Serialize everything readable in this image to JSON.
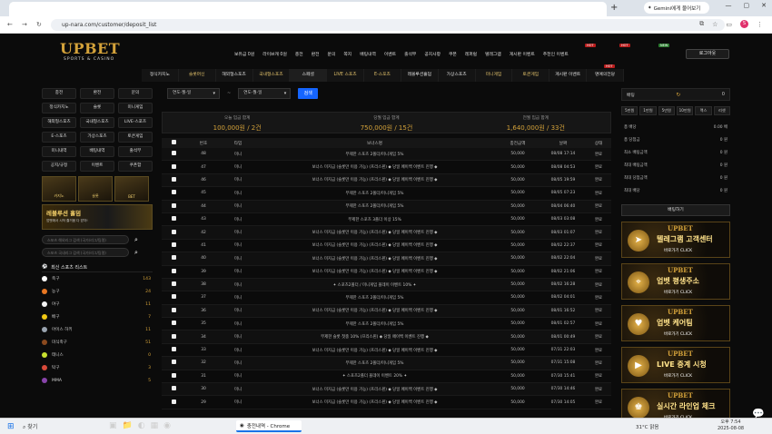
{
  "browser": {
    "gemini_label": "Gemini에게 물어보기",
    "url": "up-nara.com/customer/deposit_list",
    "profile_initial": "S"
  },
  "site": {
    "logo": "UPBET",
    "logo_sub": "SPORTS & CASINO",
    "top_links": [
      "보유금 0원",
      "라이브캐 0원",
      "충전",
      "환전",
      "문의",
      "쪽지",
      "배팅내역",
      "이벤트",
      "출석부",
      "공지사항",
      "쿠폰",
      "레퍼럴",
      "텔레그램",
      "게시판 이벤트",
      "추천인 이벤트"
    ],
    "hot_label": "HOT",
    "new_label": "NEW",
    "logout_label": "로그아웃",
    "main_nav": [
      "정식카지노",
      "슬롯머신",
      "해외형스포츠",
      "국내형스포츠",
      "스페셜",
      "LIVE 스포츠",
      "E-스포츠",
      "레볼루션홀덤",
      "가상스포츠",
      "미니게임",
      "토큰게임",
      "게시판 이벤트",
      "명예의전당"
    ]
  },
  "left": {
    "grid": [
      "충전",
      "환전",
      "문의",
      "정식카지노",
      "슬롯",
      "미니게임",
      "해외형스포츠",
      "국내형스포츠",
      "LIVE-스포츠",
      "E-스포츠",
      "가상스포츠",
      "토큰게임",
      "미니내역",
      "배팅내역",
      "출석부",
      "공지/규정",
      "이벤트",
      "쿠폰함"
    ],
    "banners": [
      "카지노",
      "슬롯",
      "BET"
    ],
    "evo_title": "레볼루션 홀덤",
    "evo_sub": "업벳에서 시작 즐거움 다 받자!",
    "search_placeholders": [
      "스포츠 해외리그 검색 (국가/리그/팀명)",
      "스포츠 국내리그 검색 (국가/리그/팀명)"
    ],
    "sports_head": "최신 스포츠 리스트",
    "sports": [
      {
        "name": "축구",
        "count": "143",
        "color": "#ffffff"
      },
      {
        "name": "농구",
        "count": "24",
        "color": "#e87722"
      },
      {
        "name": "야구",
        "count": "11",
        "color": "#f4f4f4"
      },
      {
        "name": "배구",
        "count": "7",
        "color": "#f0c814"
      },
      {
        "name": "아이스 하키",
        "count": "11",
        "color": "#9aa4b0"
      },
      {
        "name": "미식축구",
        "count": "51",
        "color": "#8b4a1e"
      },
      {
        "name": "테니스",
        "count": "0",
        "color": "#c8e030"
      },
      {
        "name": "탁구",
        "count": "3",
        "color": "#d84a3a"
      },
      {
        "name": "MMA",
        "count": "5",
        "color": "#8844aa"
      }
    ]
  },
  "content": {
    "date_placeholder": "연도-월-일",
    "search_label": "검색",
    "summary": [
      {
        "label": "오늘 입금 합계",
        "value": "100,000원 / 2건"
      },
      {
        "label": "당월 입금 합계",
        "value": "750,000원 / 15건"
      },
      {
        "label": "전월 입금 합계",
        "value": "1,640,000원 / 33건"
      }
    ],
    "headers": [
      "번호",
      "타입",
      "보너스명",
      "충전금액",
      "날짜",
      "상태"
    ],
    "rows": [
      {
        "no": "48",
        "type": "미니",
        "bonus": "무제한 스포츠 2폴더/미니게임 5%",
        "amount": "50,000",
        "date": "08/08 17:14",
        "status": "완료"
      },
      {
        "no": "47",
        "type": "미니",
        "bonus": "보너스 미지급 (슬롯만 이용 가능) (프리스핀) ◆ 당일 페이백 이벤트 진행 ◆",
        "amount": "50,000",
        "date": "08/08 04:53",
        "status": "완료"
      },
      {
        "no": "46",
        "type": "미니",
        "bonus": "보너스 미지급 (슬롯만 이용 가능) (프리스핀) ◆ 당일 페이백 이벤트 진행 ◆",
        "amount": "50,000",
        "date": "08/05 19:59",
        "status": "완료"
      },
      {
        "no": "45",
        "type": "미니",
        "bonus": "무제한 스포츠 2폴더/미니게임 5%",
        "amount": "50,000",
        "date": "08/05 07:23",
        "status": "완료"
      },
      {
        "no": "44",
        "type": "미니",
        "bonus": "무제한 스포츠 2폴더/미니게임 5%",
        "amount": "50,000",
        "date": "08/04 06:40",
        "status": "완료"
      },
      {
        "no": "43",
        "type": "미니",
        "bonus": "무제한 스포츠 3폴더 이상 15%",
        "amount": "50,000",
        "date": "08/03 03:08",
        "status": "완료"
      },
      {
        "no": "42",
        "type": "미니",
        "bonus": "보너스 미지급 (슬롯만 이용 가능) (프리스핀) ◆ 당일 페이백 이벤트 진행 ◆",
        "amount": "50,000",
        "date": "08/03 01:07",
        "status": "완료"
      },
      {
        "no": "41",
        "type": "미니",
        "bonus": "보너스 미지급 (슬롯만 이용 가능) (프리스핀) ◆ 당일 페이백 이벤트 진행 ◆",
        "amount": "50,000",
        "date": "08/02 22:37",
        "status": "완료"
      },
      {
        "no": "40",
        "type": "미니",
        "bonus": "보너스 미지급 (슬롯만 이용 가능) (프리스핀) ◆ 당일 페이백 이벤트 진행 ◆",
        "amount": "50,000",
        "date": "08/02 22:04",
        "status": "완료"
      },
      {
        "no": "39",
        "type": "미니",
        "bonus": "보너스 미지급 (슬롯만 이용 가능) (프리스핀) ◆ 당일 페이백 이벤트 진행 ◆",
        "amount": "50,000",
        "date": "08/02 21:06",
        "status": "완료"
      },
      {
        "no": "38",
        "type": "미니",
        "bonus": "✦ 스포츠2폴더 / 미니게임 올데이 이벤트 10% ✦",
        "amount": "50,000",
        "date": "08/02 16:28",
        "status": "완료"
      },
      {
        "no": "37",
        "type": "미니",
        "bonus": "무제한 스포츠 2폴더/미니게임 5%",
        "amount": "50,000",
        "date": "08/02 04:01",
        "status": "완료"
      },
      {
        "no": "36",
        "type": "미니",
        "bonus": "보너스 미지급 (슬롯만 이용 가능) (프리스핀) ◆ 당일 페이백 이벤트 진행 ◆",
        "amount": "50,000",
        "date": "08/01 16:52",
        "status": "완료"
      },
      {
        "no": "35",
        "type": "미니",
        "bonus": "무제한 스포츠 2폴더/미니게임 5%",
        "amount": "50,000",
        "date": "08/01 02:57",
        "status": "완료"
      },
      {
        "no": "34",
        "type": "미니",
        "bonus": "무제한 슬롯 첫충 10% (프리스핀) ◆ 당일 페이백 이벤트 진행 ◆",
        "amount": "50,000",
        "date": "08/01 00:49",
        "status": "완료"
      },
      {
        "no": "33",
        "type": "미니",
        "bonus": "보너스 미지급 (슬롯만 이용 가능) (프리스핀) ◆ 당일 페이백 이벤트 진행 ◆",
        "amount": "50,000",
        "date": "07/31 22:03",
        "status": "완료"
      },
      {
        "no": "32",
        "type": "미니",
        "bonus": "무제한 스포츠 2폴더/미니게임 5%",
        "amount": "50,000",
        "date": "07/31 15:08",
        "status": "완료"
      },
      {
        "no": "31",
        "type": "미니",
        "bonus": "✦ 스포츠2폴더 올데이 이벤트 20% ✦",
        "amount": "50,000",
        "date": "07/30 15:41",
        "status": "완료"
      },
      {
        "no": "30",
        "type": "미니",
        "bonus": "보너스 미지급 (슬롯만 이용 가능) (프리스핀) ◆ 당일 페이백 이벤트 진행 ◆",
        "amount": "50,000",
        "date": "07/30 14:46",
        "status": "완료"
      },
      {
        "no": "29",
        "type": "미니",
        "bonus": "보너스 미지급 (슬롯만 이용 가능) (프리스핀) ◆ 당일 페이백 이벤트 진행 ◆",
        "amount": "50,000",
        "date": "07/30 14:05",
        "status": "완료"
      }
    ]
  },
  "right": {
    "bet_label": "배팅",
    "bet_value": "0",
    "amount_buttons": [
      "5만원",
      "1만원",
      "5만원",
      "10만원",
      "맥스",
      "리셋"
    ],
    "stats": [
      {
        "label": "총 배당",
        "value": "0.00 배"
      },
      {
        "label": "총 당첨금",
        "value": "0 원"
      },
      {
        "label": "최소 배팅금액",
        "value": "0 원"
      },
      {
        "label": "최대 배팅금액",
        "value": "0 원"
      },
      {
        "label": "최대 당첨금액",
        "value": "0 원"
      },
      {
        "label": "최대 배당",
        "value": "0 원"
      }
    ],
    "apply_label": "배팅하기",
    "promo_brand": "UPBET",
    "promo_cta": "바로가기 CLICK",
    "promos": [
      {
        "title": "텔레그램 고객센터",
        "icon": "telegram-icon"
      },
      {
        "title": "업벳 평생주소",
        "icon": "location-icon"
      },
      {
        "title": "업벳 케어팀",
        "icon": "heart-icon"
      },
      {
        "title": "LIVE 중계 시청",
        "icon": "live-icon"
      },
      {
        "title": "실시간 라인업 체크",
        "icon": "player-icon"
      }
    ]
  },
  "taskbar": {
    "search": "찾기",
    "chrome_label": "충전내역 - Chrome",
    "weather": "31°C 맑음",
    "time": "오후 7:54",
    "date": "2025-08-08"
  }
}
